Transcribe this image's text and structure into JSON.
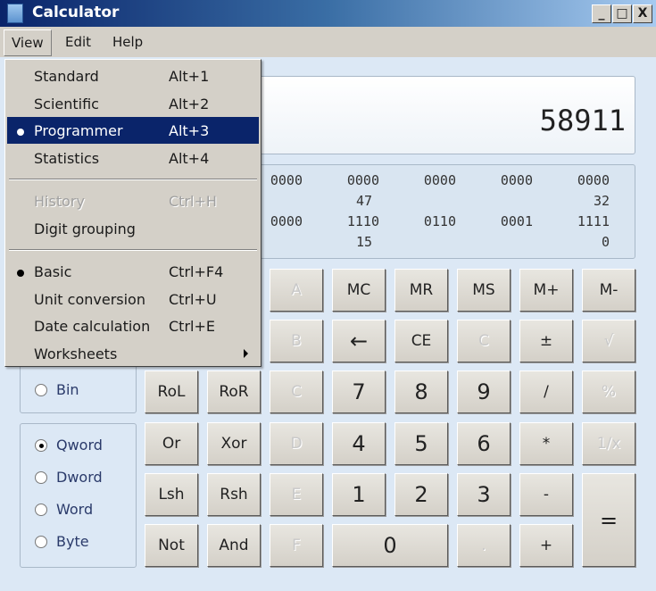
{
  "window": {
    "title": "Calculator",
    "minimize": "_",
    "maximize": "□",
    "close": "X"
  },
  "menubar": [
    "View",
    "Edit",
    "Help"
  ],
  "view_menu": {
    "groups": [
      [
        {
          "label": "Standard",
          "shortcut": "Alt+1"
        },
        {
          "label": "Scientific",
          "shortcut": "Alt+2"
        },
        {
          "label": "Programmer",
          "shortcut": "Alt+3",
          "checked": true,
          "highlighted": true
        },
        {
          "label": "Statistics",
          "shortcut": "Alt+4"
        }
      ],
      [
        {
          "label": "History",
          "shortcut": "Ctrl+H",
          "disabled": true
        },
        {
          "label": "Digit grouping",
          "shortcut": ""
        }
      ],
      [
        {
          "label": "Basic",
          "shortcut": "Ctrl+F4",
          "checked": true
        },
        {
          "label": "Unit conversion",
          "shortcut": "Ctrl+U"
        },
        {
          "label": "Date calculation",
          "shortcut": "Ctrl+E"
        },
        {
          "label": "Worksheets",
          "shortcut": "",
          "submenu": true
        }
      ]
    ]
  },
  "display": {
    "value": "58911"
  },
  "bits": {
    "row1": [
      "0000",
      "0000",
      "0000",
      "0000",
      "0000"
    ],
    "row1_labels": [
      "47",
      "32"
    ],
    "row2": [
      "0000",
      "1110",
      "0110",
      "0001",
      "1111"
    ],
    "row2_labels": [
      "15",
      "0"
    ]
  },
  "radix": {
    "bin": "Bin"
  },
  "word_size": {
    "options": [
      "Qword",
      "Dword",
      "Word",
      "Byte"
    ],
    "selected": "Qword"
  },
  "buttons": [
    [
      "",
      "",
      "A",
      "MC",
      "MR",
      "MS",
      "M+",
      "M-"
    ],
    [
      "",
      "",
      "B",
      "←",
      "CE",
      "C",
      "±",
      "√"
    ],
    [
      "RoL",
      "RoR",
      "C",
      "7",
      "8",
      "9",
      "/",
      "%"
    ],
    [
      "Or",
      "Xor",
      "D",
      "4",
      "5",
      "6",
      "*",
      "1/x"
    ],
    [
      "Lsh",
      "Rsh",
      "E",
      "1",
      "2",
      "3",
      "-",
      "="
    ],
    [
      "Not",
      "And",
      "F",
      "0",
      "",
      ".",
      "+",
      ""
    ]
  ],
  "disabled_buttons": [
    "A",
    "B",
    "C",
    "D",
    "E",
    "F",
    "√",
    "%",
    "1/x",
    "."
  ]
}
